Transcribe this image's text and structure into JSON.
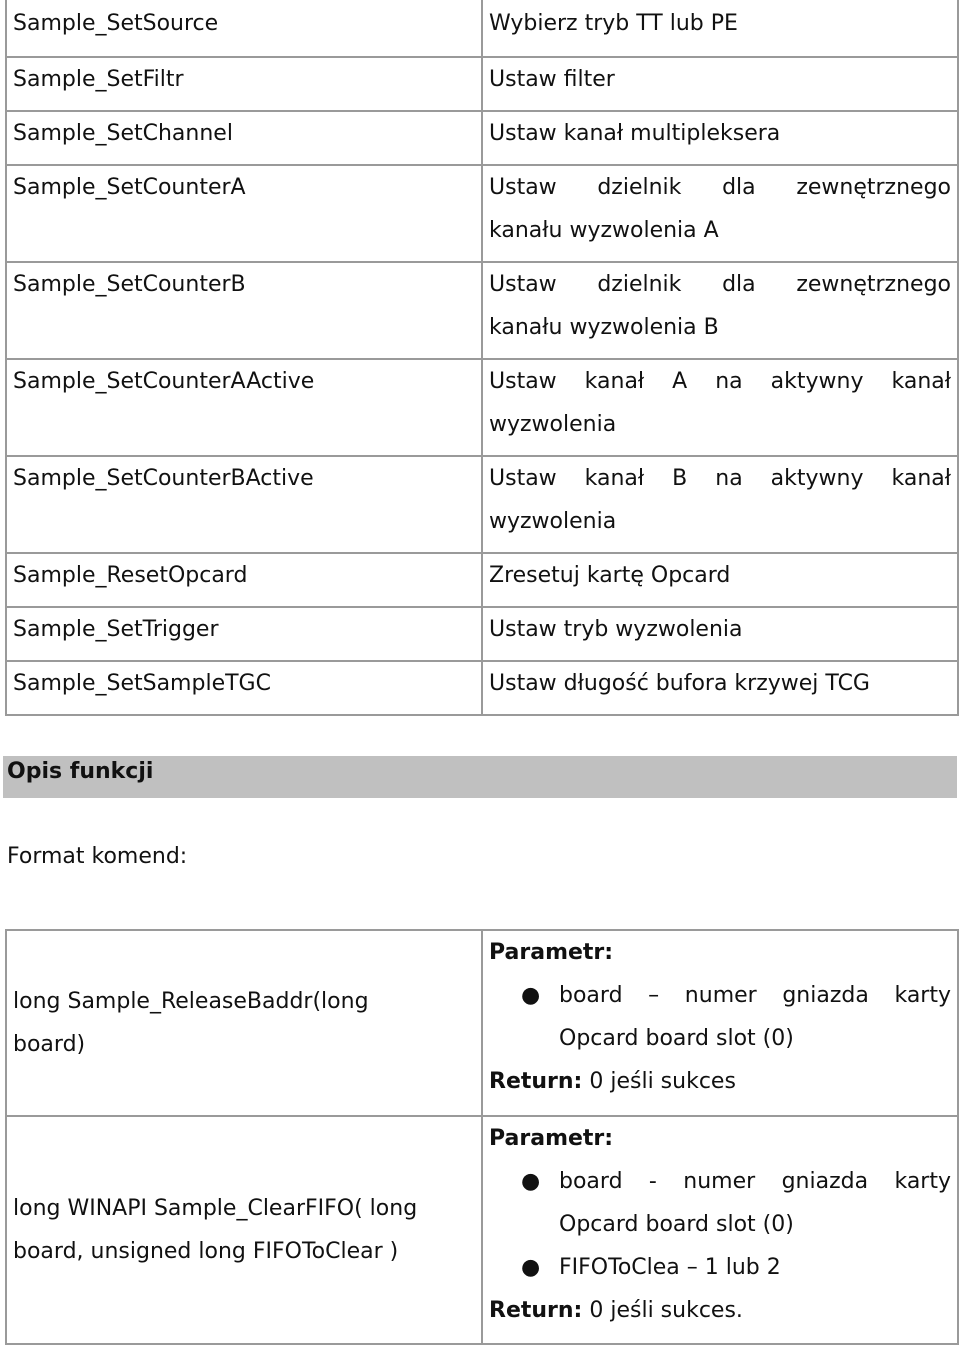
{
  "function_table": {
    "rows": [
      {
        "name": "Sample_SetSource",
        "desc1": "Wybierz tryb TT lub PE",
        "desc2": ""
      },
      {
        "name": "Sample_SetFiltr",
        "desc1": "Ustaw filter",
        "desc2": ""
      },
      {
        "name": "Sample_SetChannel",
        "desc1": "Ustaw kanał multipleksera",
        "desc2": ""
      },
      {
        "name": "Sample_SetCounterA",
        "desc1": "Ustaw dzielnik dla zewnętrznego",
        "desc2": "kanału wyzwolenia A"
      },
      {
        "name": "Sample_SetCounterB",
        "desc1": "Ustaw dzielnik dla zewnętrznego",
        "desc2": "kanału wyzwolenia B"
      },
      {
        "name": "Sample_SetCounterAActive",
        "desc1": "Ustaw kanał A na aktywny kanał",
        "desc2": "wyzwolenia"
      },
      {
        "name": "Sample_SetCounterBActive",
        "desc1": "Ustaw kanał B na aktywny kanał",
        "desc2": "wyzwolenia"
      },
      {
        "name": "Sample_ResetOpcard",
        "desc1": "Zresetuj kartę Opcard",
        "desc2": ""
      },
      {
        "name": "Sample_SetTrigger",
        "desc1": "Ustaw tryb wyzwolenia",
        "desc2": ""
      },
      {
        "name": "Sample_SetSampleTGC",
        "desc1": "Ustaw długość bufora krzywej TCG",
        "desc2": ""
      }
    ]
  },
  "section": {
    "title": "Opis funkcji",
    "format_label": "Format komend:",
    "header_color": "#c0c0c0"
  },
  "commands": [
    {
      "sig1": "long Sample_ReleaseBaddr(long",
      "sig2": "board)",
      "param_label": "Parametr:",
      "params": [
        {
          "line1": "board – numer gniazda karty",
          "line2": "Opcard board slot (0)"
        }
      ],
      "return_label": "Return:",
      "return_value": " 0 jeśli sukces"
    },
    {
      "sig1": "long WINAPI Sample_ClearFIFO( long",
      "sig2": "board, unsigned long FIFOToClear )",
      "param_label": "Parametr:",
      "params": [
        {
          "line1": "board - numer gniazda karty",
          "line2": "Opcard board slot (0)"
        },
        {
          "line1": "FIFOToClea – 1 lub 2",
          "line2": ""
        }
      ],
      "return_label": "Return:",
      "return_value": " 0 jeśli sukces."
    }
  ],
  "icons": {
    "bullet": "●"
  }
}
